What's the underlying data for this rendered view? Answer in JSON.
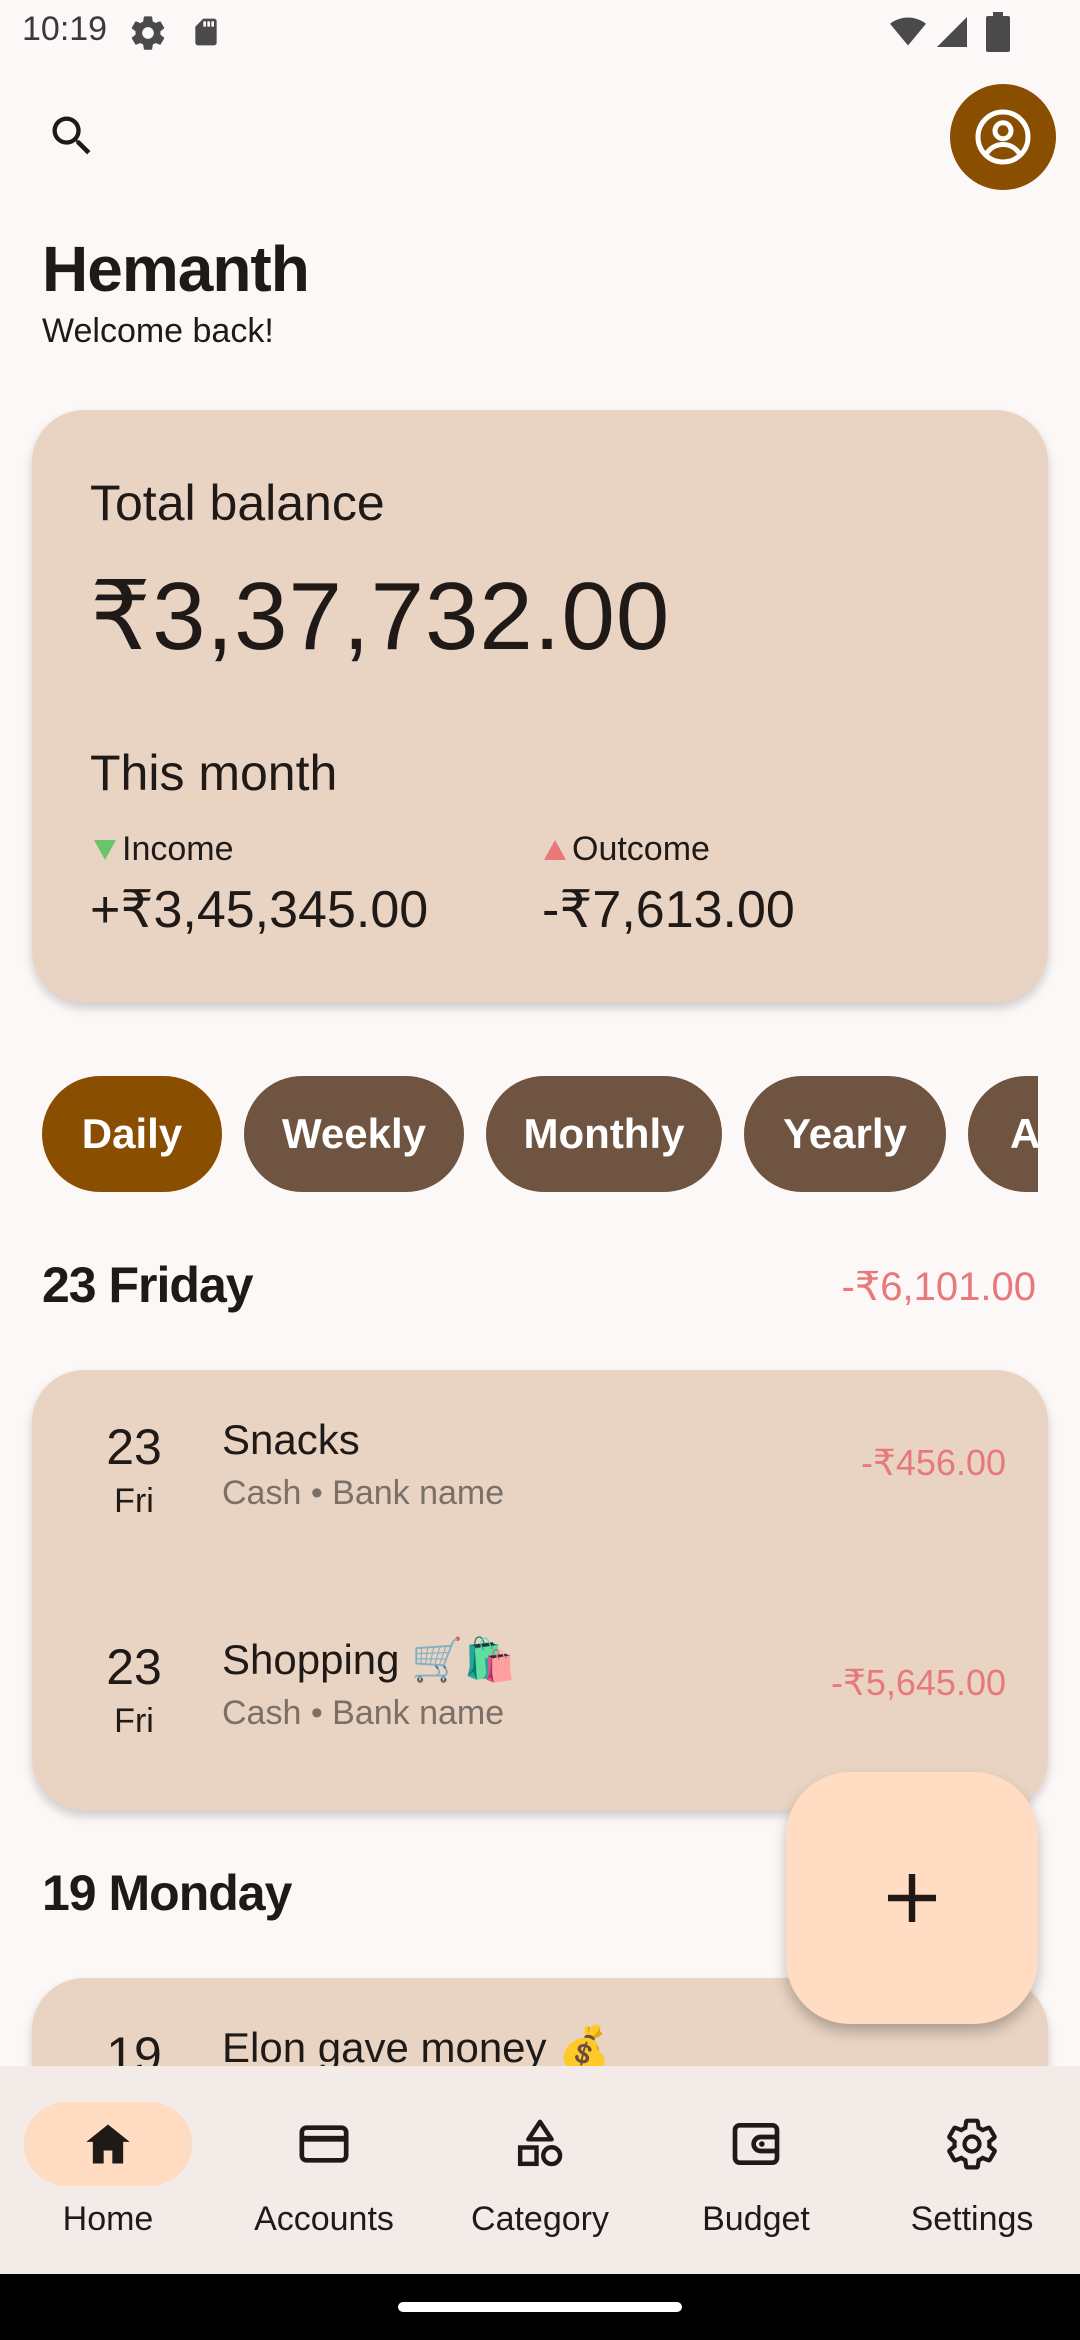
{
  "status_bar": {
    "time": "10:19",
    "icons": [
      "settings-gear-icon",
      "sd-card-icon",
      "wifi-icon",
      "signal-icon",
      "battery-icon"
    ]
  },
  "header": {
    "search_icon": "search-icon",
    "profile_icon": "account-circle-icon"
  },
  "greeting": {
    "name": "Hemanth",
    "subtitle": "Welcome back!"
  },
  "balance": {
    "label": "Total balance",
    "value": "₹3,37,732.00",
    "month_label": "This month",
    "income_label": "Income",
    "income_value": "+₹3,45,345.00",
    "outcome_label": "Outcome",
    "outcome_value": "-₹7,613.00"
  },
  "filters": {
    "chips": [
      {
        "label": "Daily",
        "active": true
      },
      {
        "label": "Weekly",
        "active": false
      },
      {
        "label": "Monthly",
        "active": false
      },
      {
        "label": "Yearly",
        "active": false
      },
      {
        "label": "A",
        "active": false
      }
    ]
  },
  "days": [
    {
      "header": "23 Friday",
      "total": "-₹6,101.00",
      "transactions": [
        {
          "day": "23",
          "weekday": "Fri",
          "title": "Snacks",
          "subtitle": "Cash • Bank name",
          "amount": "-₹456.00"
        },
        {
          "day": "23",
          "weekday": "Fri",
          "title": "Shopping 🛒🛍️",
          "subtitle": "Cash • Bank name",
          "amount": "-₹5,645.00"
        }
      ]
    },
    {
      "header": "19 Monday",
      "total": "",
      "transactions": [
        {
          "day": "19",
          "weekday": "",
          "title": "Elon gave money 💰",
          "subtitle": "",
          "amount": ""
        }
      ]
    }
  ],
  "fab": {
    "icon": "plus-icon"
  },
  "bottom_nav": {
    "items": [
      {
        "label": "Home",
        "icon": "home-icon",
        "active": true
      },
      {
        "label": "Accounts",
        "icon": "credit-card-icon",
        "active": false
      },
      {
        "label": "Category",
        "icon": "category-shapes-icon",
        "active": false
      },
      {
        "label": "Budget",
        "icon": "wallet-icon",
        "active": false
      },
      {
        "label": "Settings",
        "icon": "settings-icon",
        "active": false
      }
    ]
  },
  "colors": {
    "background": "#FDF8F8",
    "card": "#E9D4C3",
    "accent": "#8A4E00",
    "chip": "#6F5442",
    "negative": "#E7797A",
    "positive": "#6CC46A",
    "fab": "#FFDCC2"
  }
}
